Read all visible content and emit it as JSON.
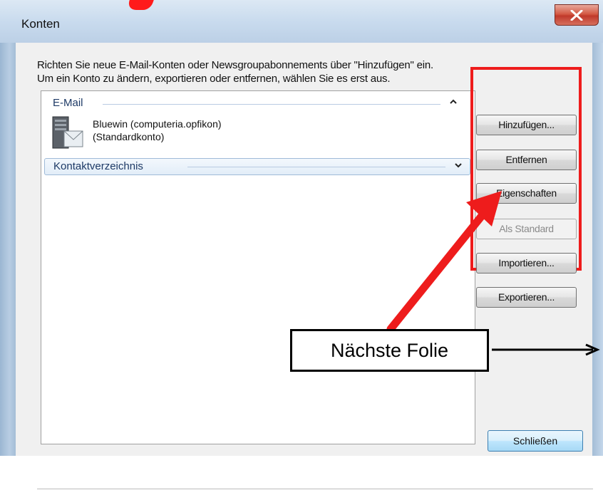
{
  "window": {
    "title": "Konten",
    "close_icon": "close-x-icon",
    "intro_line1": "Richten Sie neue E-Mail-Konten oder Newsgroupabonnements über \"Hinzufügen\" ein.",
    "intro_line2": "Um ein Konto zu ändern, exportieren oder entfernen, wählen Sie es erst aus."
  },
  "list": {
    "groups": [
      {
        "label": "E-Mail",
        "expanded": true
      },
      {
        "label": "Kontaktverzeichnis",
        "expanded": false
      }
    ],
    "account": {
      "name": "Bluewin (computeria.opfikon)",
      "note": "(Standardkonto)",
      "icon": "mail-server-icon"
    }
  },
  "buttons": {
    "add": "Hinzufügen...",
    "remove": "Entfernen",
    "properties": "Eigenschaften",
    "set_default": "Als Standard",
    "import": "Importieren...",
    "export": "Exportieren...",
    "close": "Schließen"
  },
  "annotation": {
    "callout": "Nächste Folie",
    "color": "#ee1c1c"
  }
}
